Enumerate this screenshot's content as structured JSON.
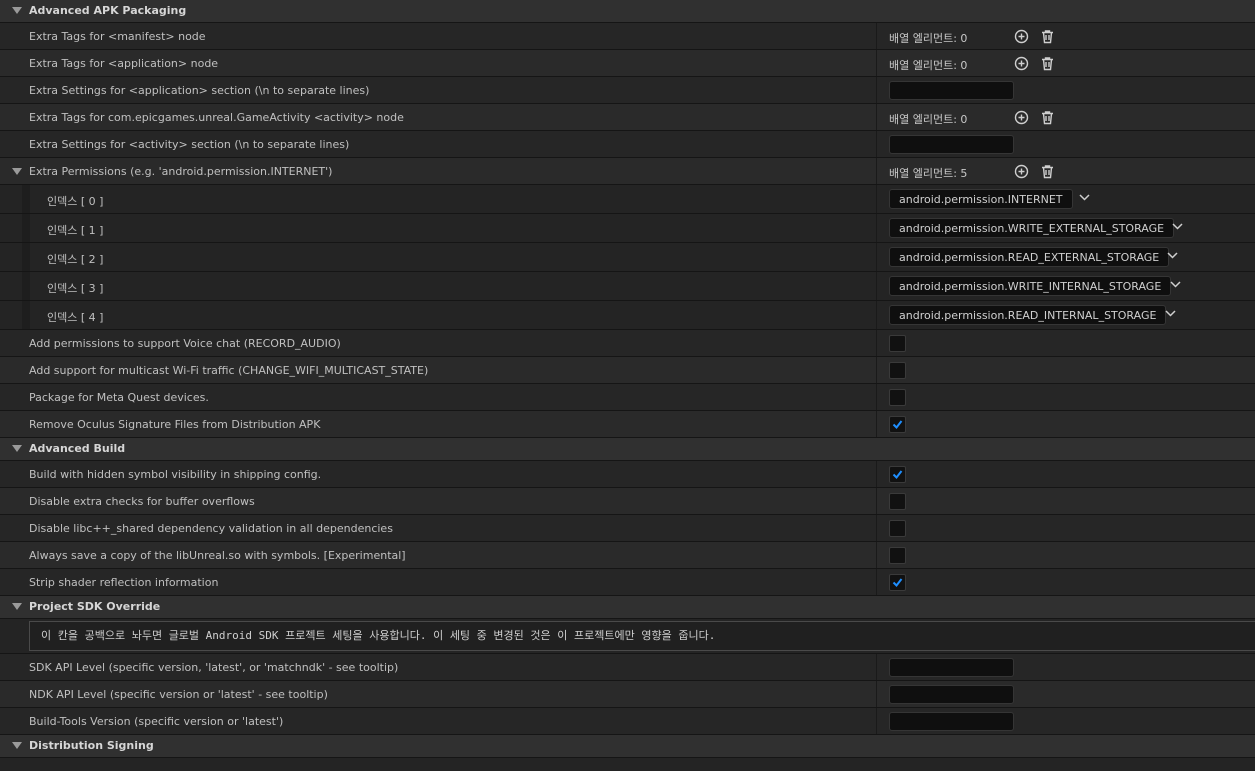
{
  "sections": {
    "apk_packaging": "Advanced APK Packaging",
    "advanced_build": "Advanced Build",
    "project_sdk_override": "Project SDK Override",
    "distribution_signing": "Distribution Signing"
  },
  "apk": {
    "manifest_tags_label": "Extra Tags for <manifest> node",
    "manifest_tags_value": "배열 엘리먼트: 0",
    "application_tags_label": "Extra Tags for <application> node",
    "application_tags_value": "배열 엘리먼트: 0",
    "application_settings_label": "Extra Settings for <application> section (\\n to separate lines)",
    "activity_tags_label": "Extra Tags for com.epicgames.unreal.GameActivity <activity> node",
    "activity_tags_value": "배열 엘리먼트: 0",
    "activity_settings_label": "Extra Settings for <activity> section (\\n to separate lines)",
    "permissions_label": "Extra Permissions (e.g. 'android.permission.INTERNET')",
    "permissions_value": "배열 엘리먼트: 5",
    "permissions": [
      {
        "index": "인덱스 [ 0 ]",
        "value": "android.permission.INTERNET"
      },
      {
        "index": "인덱스 [ 1 ]",
        "value": "android.permission.WRITE_EXTERNAL_STORAGE"
      },
      {
        "index": "인덱스 [ 2 ]",
        "value": "android.permission.READ_EXTERNAL_STORAGE"
      },
      {
        "index": "인덱스 [ 3 ]",
        "value": "android.permission.WRITE_INTERNAL_STORAGE"
      },
      {
        "index": "인덱스 [ 4 ]",
        "value": "android.permission.READ_INTERNAL_STORAGE"
      }
    ],
    "voice_chat_label": "Add permissions to support Voice chat (RECORD_AUDIO)",
    "voice_chat_checked": false,
    "multicast_label": "Add support for multicast Wi-Fi traffic (CHANGE_WIFI_MULTICAST_STATE)",
    "multicast_checked": false,
    "meta_quest_label": "Package for Meta Quest devices.",
    "meta_quest_checked": false,
    "remove_oculus_label": "Remove Oculus Signature Files from Distribution APK",
    "remove_oculus_checked": true
  },
  "build": {
    "hidden_symbol_label": "Build with hidden symbol visibility in shipping config.",
    "hidden_symbol_checked": true,
    "buffer_overflow_label": "Disable extra checks for buffer overflows",
    "buffer_overflow_checked": false,
    "libcxx_label": "Disable libc++_shared dependency validation in all dependencies",
    "libcxx_checked": false,
    "save_copy_label": "Always save a copy of the libUnreal.so with symbols. [Experimental]",
    "save_copy_checked": false,
    "strip_shader_label": "Strip shader reflection information",
    "strip_shader_checked": true
  },
  "sdk": {
    "note": "이 칸을 공백으로 놔두면 글로벌 Android SDK 프로젝트 세팅을 사용합니다. 이 세팅 중 변경된 것은 이 프로젝트에만 영향을 줍니다.",
    "sdk_api_label": "SDK API Level (specific version, 'latest', or 'matchndk' - see tooltip)",
    "sdk_api_value": "",
    "ndk_api_label": "NDK API Level (specific version or 'latest' - see tooltip)",
    "ndk_api_value": "",
    "build_tools_label": "Build-Tools Version (specific version or 'latest')",
    "build_tools_value": ""
  },
  "icons": {
    "add": "plus-circle-icon",
    "delete": "trash-icon",
    "expand": "chevron-down-icon",
    "collapse": "triangle-down-icon"
  },
  "colors": {
    "background": "#242424",
    "section": "#303030",
    "check_accent": "#1f8fff"
  }
}
